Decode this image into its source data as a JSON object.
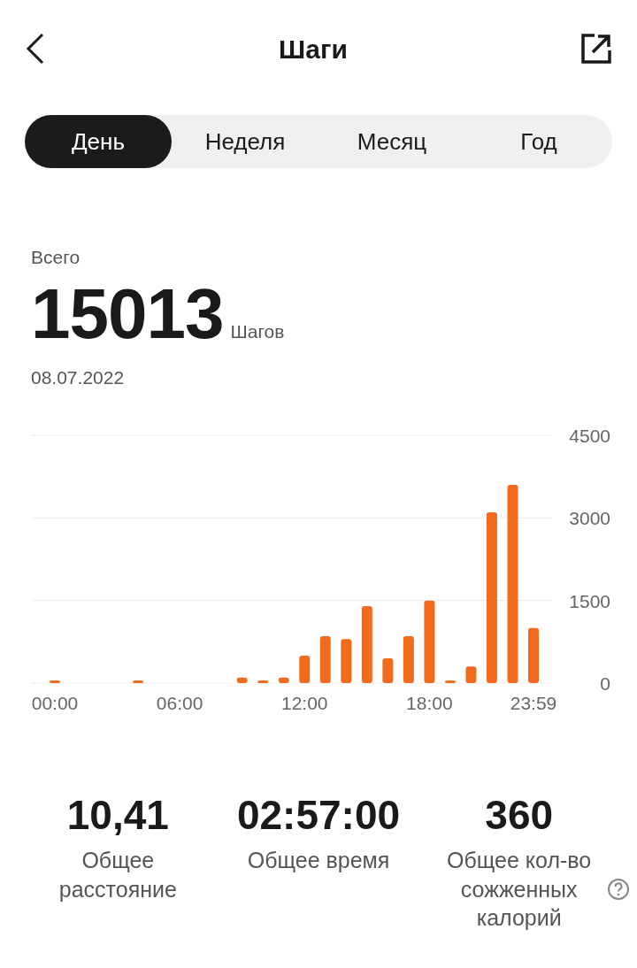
{
  "header": {
    "title": "Шаги"
  },
  "tabs": [
    {
      "label": "День",
      "selected": true
    },
    {
      "label": "Неделя",
      "selected": false
    },
    {
      "label": "Месяц",
      "selected": false
    },
    {
      "label": "Год",
      "selected": false
    }
  ],
  "summary": {
    "label": "Всего",
    "value": "15013",
    "unit": "Шагов",
    "date": "08.07.2022"
  },
  "chart": {
    "chart_data": {
      "type": "bar",
      "x": [
        0,
        4,
        9,
        10,
        11,
        12,
        13,
        14,
        15,
        16,
        17,
        18,
        19,
        20,
        21,
        22,
        23
      ],
      "series": [
        {
          "color": "#f26b1d",
          "values": [
            50,
            50,
            100,
            50,
            100,
            500,
            850,
            800,
            1400,
            450,
            850,
            1500,
            50,
            300,
            3100,
            3600,
            1000
          ]
        }
      ],
      "xlim": [
        0,
        23.98
      ],
      "ylim": [
        0,
        4500
      ],
      "yticks": [
        0,
        1500,
        3000,
        4500
      ],
      "xticks": [
        {
          "value": 0,
          "label": "00:00"
        },
        {
          "value": 6,
          "label": "06:00"
        },
        {
          "value": 12,
          "label": "12:00"
        },
        {
          "value": 18,
          "label": "18:00"
        },
        {
          "value": 23.98,
          "label": "23:59"
        }
      ]
    }
  },
  "stats": [
    {
      "value": "10,41",
      "label": "Общее расстояние",
      "help": false
    },
    {
      "value": "02:57:00",
      "label": "Общее время",
      "help": false
    },
    {
      "value": "360",
      "label": "Общее кол-во сожженных калорий",
      "help": true
    }
  ]
}
